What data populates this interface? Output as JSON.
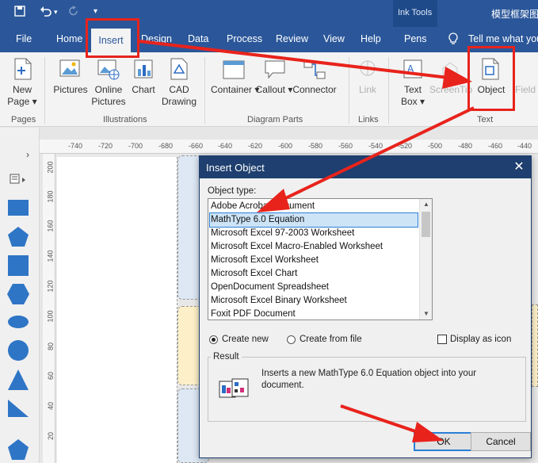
{
  "titlebar": {
    "title": "模型框架图",
    "contextual_tab": "Ink Tools",
    "colors": {
      "bar": "#2b579a",
      "contextual": "#1e4a8a"
    }
  },
  "tabs": [
    "File",
    "Home",
    "Insert",
    "Design",
    "Data",
    "Process",
    "Review",
    "View",
    "Help",
    "Pens"
  ],
  "active_tab": "Insert",
  "tell_me": "Tell me what you",
  "ribbon": {
    "new_page": {
      "line1": "New",
      "line2": "Page ▾"
    },
    "pictures": "Pictures",
    "online_pictures": {
      "line1": "Online",
      "line2": "Pictures"
    },
    "chart": "Chart",
    "cad_drawing": {
      "line1": "CAD",
      "line2": "Drawing"
    },
    "container": "Container ▾",
    "callout": "Callout ▾",
    "connector": "Connector",
    "link": "Link",
    "text_box": {
      "line1": "Text",
      "line2": "Box ▾"
    },
    "screentip": "ScreenTip",
    "object": "Object",
    "field": "Field",
    "groups": [
      "Pages",
      "Illustrations",
      "Diagram Parts",
      "Links",
      "Text"
    ]
  },
  "ruler": {
    "h_ticks": [
      "-740",
      "-720",
      "-700",
      "-680",
      "-660",
      "-640",
      "-620",
      "-600",
      "-580",
      "-560",
      "-540",
      "-520",
      "-500",
      "-480",
      "-460",
      "-440"
    ],
    "v_ticks": [
      "200",
      "180",
      "160",
      "140",
      "120",
      "100",
      "80",
      "60",
      "40",
      "20"
    ]
  },
  "dialog": {
    "title": "Insert Object",
    "object_type_label": "Object type:",
    "items": [
      "Adobe Acrobat Document",
      "MathType 6.0 Equation",
      "Microsoft Excel 97-2003 Worksheet",
      "Microsoft Excel Macro-Enabled Worksheet",
      "Microsoft Excel Worksheet",
      "Microsoft Excel Chart",
      "OpenDocument Spreadsheet",
      "Microsoft Excel Binary Worksheet",
      "Foxit PDF Document"
    ],
    "selected_index": 1,
    "create_new": "Create new",
    "create_from_file": "Create from file",
    "display_as_icon": "Display as icon",
    "result_label": "Result",
    "result_text": "Inserts a new MathType 6.0 Equation object into your document.",
    "ok": "OK",
    "cancel": "Cancel"
  },
  "annotation_color": "#e8231c"
}
